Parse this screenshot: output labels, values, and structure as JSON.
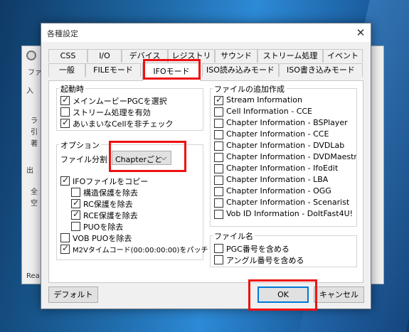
{
  "background_window": {
    "title_fragment": "ファ",
    "items": [
      "入",
      "ラ",
      "引",
      "著",
      "出",
      "全",
      "空"
    ],
    "status_fragment": "Rea"
  },
  "dialog": {
    "title": "各種設定",
    "close_glyph": "✕",
    "tabs_row1": [
      "CSS",
      "I/O",
      "デバイス",
      "レジストリ",
      "サウンド",
      "ストリーム処理",
      "イベント"
    ],
    "tabs_row2": [
      "一般",
      "FILEモード",
      "IFOモード",
      "ISO読み込みモード",
      "ISO書き込みモード"
    ],
    "selected_tab": "IFOモード"
  },
  "startup": {
    "label": "起動時",
    "options": [
      {
        "label": "メインムービーPGCを選択",
        "checked": true
      },
      {
        "label": "ストリーム処理を有効",
        "checked": false
      },
      {
        "label": "あいまいなCellを非チェック",
        "checked": true
      }
    ]
  },
  "options": {
    "label": "オプション",
    "split_label": "ファイル分割",
    "split_value": "Chapterごと",
    "ifo_copy": {
      "label": "IFOファイルをコピー",
      "checked": true
    },
    "ifo_sub": [
      {
        "label": "構造保護を除去",
        "checked": false
      },
      {
        "label": "RC保護を除去",
        "checked": true
      },
      {
        "label": "RCE保護を除去",
        "checked": true
      },
      {
        "label": "PUOを除去",
        "checked": false
      }
    ],
    "vob_puo": {
      "label": "VOB PUOを除去",
      "checked": false
    },
    "m2v": {
      "label": "M2Vタイムコード(00:00:00:00)をパッチ",
      "checked": true
    }
  },
  "file_create": {
    "label": "ファイルの追加作成",
    "items": [
      {
        "label": "Stream Information",
        "checked": true
      },
      {
        "label": "Cell Information - CCE",
        "checked": false
      },
      {
        "label": "Chapter Information - BSPlayer",
        "checked": false
      },
      {
        "label": "Chapter Information - CCE",
        "checked": false
      },
      {
        "label": "Chapter Information - DVDLab",
        "checked": false
      },
      {
        "label": "Chapter Information - DVDMaestro",
        "checked": false
      },
      {
        "label": "Chapter Information - IfoEdit",
        "checked": false
      },
      {
        "label": "Chapter Information - LBA",
        "checked": false
      },
      {
        "label": "Chapter Information - OGG",
        "checked": false
      },
      {
        "label": "Chapter Information - Scenarist",
        "checked": false
      },
      {
        "label": "Vob ID Information - DoItFast4U!",
        "checked": false
      }
    ]
  },
  "file_name": {
    "label": "ファイル名",
    "items": [
      {
        "label": "PGC番号を含める",
        "checked": false
      },
      {
        "label": "アングル番号を含める",
        "checked": false
      }
    ]
  },
  "buttons": {
    "default": "デフォルト",
    "ok": "OK",
    "cancel": "キャンセル"
  },
  "highlight_color": "#e11111",
  "accent_color": "#0078d7"
}
